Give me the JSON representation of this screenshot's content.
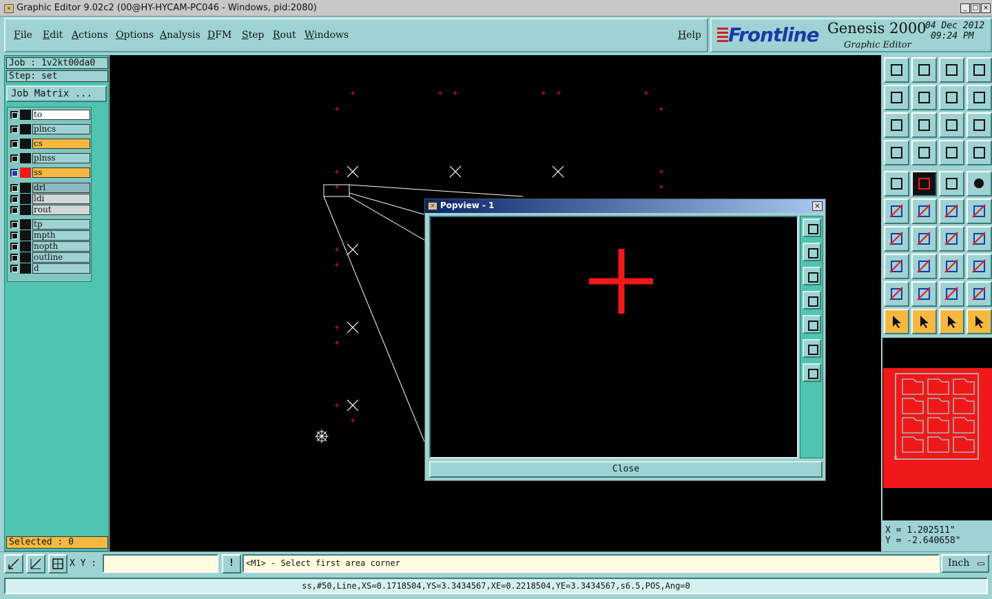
{
  "window": {
    "title": "Graphic Editor 9.02c2 (00@HY-HYCAM-PC046 - Windows, pid:2080)",
    "controls": [
      "_",
      "□",
      "×"
    ]
  },
  "menu": {
    "items": [
      "File",
      "Edit",
      "Actions",
      "Options",
      "Analysis",
      "DFM",
      "Step",
      "Rout",
      "Windows"
    ],
    "help": "Help"
  },
  "brand": {
    "logo": "Frontline",
    "product": "Genesis 2000",
    "module": "Graphic Editor",
    "date": "04 Dec 2012",
    "time": "09:24 PM"
  },
  "job": {
    "job_label": "Job : 1v2kt00da0",
    "step_label": "Step: set",
    "matrix_button": "Job Matrix ..."
  },
  "layers": [
    {
      "name": "to",
      "color": "#ffffff",
      "swatch": "#111111"
    },
    {
      "name": "plncs",
      "color": "#9fd3d3",
      "swatch": "#111111"
    },
    {
      "name": "cs",
      "color": "#f5b942",
      "swatch": "#111111"
    },
    {
      "name": "plnss",
      "color": "#9fd3d3",
      "swatch": "#111111"
    },
    {
      "name": "ss",
      "color": "#f5b942",
      "swatch": "#f01818",
      "active": true
    },
    {
      "name": "drl",
      "color": "#8fb8c0",
      "swatch": "#111111"
    },
    {
      "name": "ldi",
      "color": "#d0d8d8",
      "swatch": "#111111"
    },
    {
      "name": "rout",
      "color": "#d0d8d8",
      "swatch": "#111111"
    },
    {
      "name": "tp",
      "color": "#9fd3d3",
      "swatch": "#111111"
    },
    {
      "name": "mpth",
      "color": "#9fd3d3",
      "swatch": "#111111"
    },
    {
      "name": "nopth",
      "color": "#9fd3d3",
      "swatch": "#111111"
    },
    {
      "name": "outline",
      "color": "#9fd3d3",
      "swatch": "#111111"
    },
    {
      "name": "d",
      "color": "#9fd3d3",
      "swatch": "#111111"
    }
  ],
  "selected": "Selected : 0",
  "popview": {
    "title": "Popview - 1",
    "close_x": "×",
    "close_button": "Close"
  },
  "coords": {
    "x": "X = 1.202511\"",
    "y": "Y = -2.640658\""
  },
  "command": {
    "xy_label": "X Y :",
    "xy_value": "",
    "bang": "!",
    "prompt": "<M1> - Select first area corner",
    "unit": "Inch"
  },
  "status": "ss,#50,Line,XS=0.1718504,YS=3.3434567,XE=0.2218504,YE=3.3434567,s6.5,POS,Ang=0",
  "colors": {
    "panel": "#9fd3d3",
    "panel_dark": "#4fc4b0",
    "highlight": "#f5b942",
    "mark": "#f01818",
    "canvas": "#000000"
  }
}
